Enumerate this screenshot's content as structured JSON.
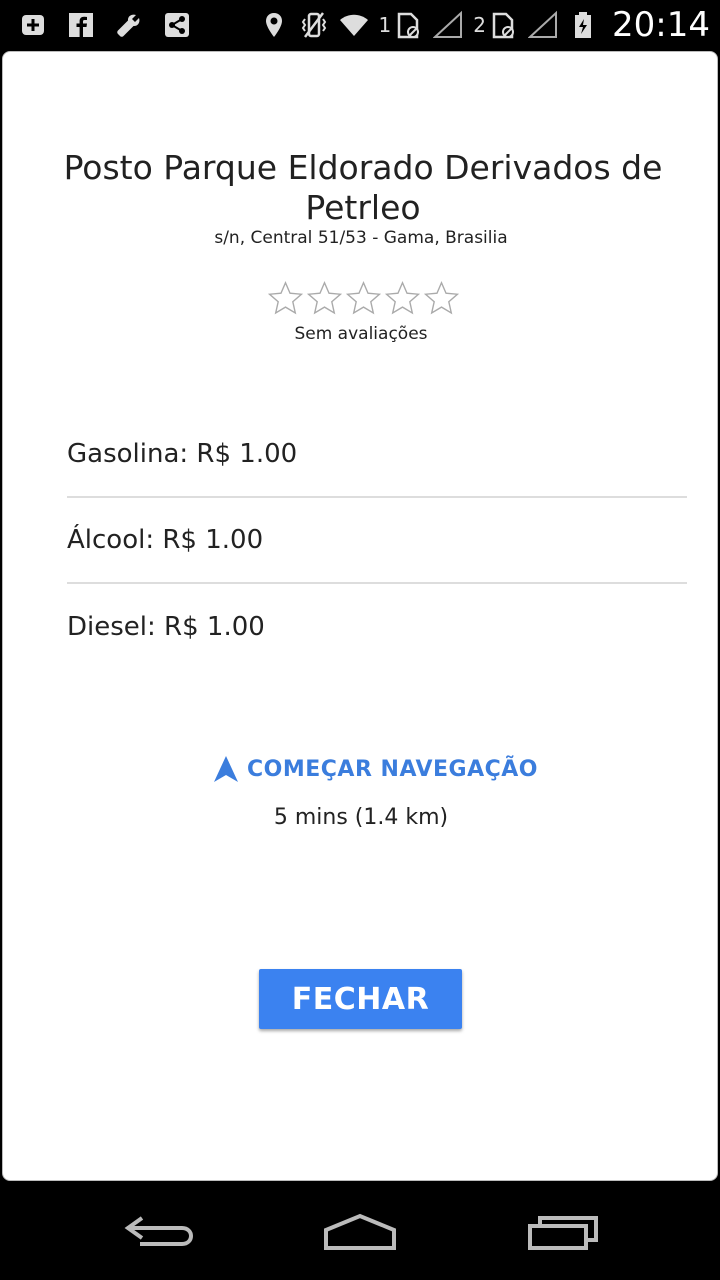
{
  "statusbar": {
    "left_icons": [
      "add-box-icon",
      "facebook-icon",
      "wrench-icon",
      "share-icon"
    ],
    "right_icons": [
      "location-icon",
      "vibrate-off-icon",
      "wifi-icon",
      "sim1-icon",
      "signal1-icon",
      "sim2-icon",
      "signal2-icon",
      "battery-icon"
    ],
    "sim1_label": "1",
    "sim2_label": "2",
    "time": "20:14"
  },
  "station": {
    "name": "Posto Parque Eldorado Derivados de Petrleo",
    "address": "s/n, Central 51/53 - Gama, Brasilia",
    "rating_stars_filled": 0,
    "rating_stars_total": 5,
    "rating_text": "Sem avaliações"
  },
  "fuels": [
    {
      "label": "Gasolina: R$ 1.00"
    },
    {
      "label": "Álcool: R$ 1.00"
    },
    {
      "label": "Diesel: R$ 1.00"
    }
  ],
  "navigation": {
    "icon": "navigation-arrow-icon",
    "label": "COMEÇAR NAVEGAÇÃO",
    "eta": "5 mins (1.4 km)"
  },
  "dialog": {
    "close_label": "FECHAR"
  },
  "colors": {
    "accent": "#3b82f0",
    "nav_text": "#3b7ddd"
  },
  "navbar": {
    "buttons": [
      "back-icon",
      "home-icon",
      "recents-icon"
    ]
  }
}
